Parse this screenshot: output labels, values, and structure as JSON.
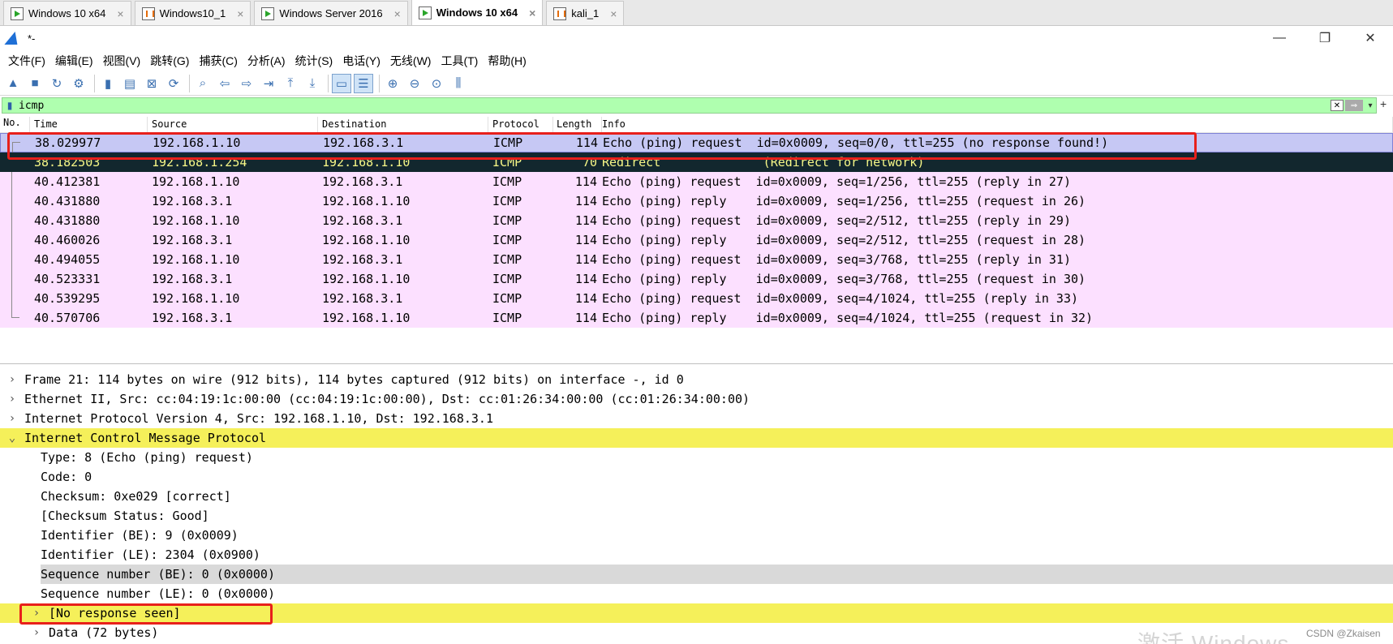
{
  "vm_tabs": [
    {
      "label": "Windows 10 x64",
      "active": false,
      "state": "running"
    },
    {
      "label": "Windows10_1",
      "active": false,
      "state": "paused"
    },
    {
      "label": "Windows Server 2016",
      "active": false,
      "state": "running"
    },
    {
      "label": "Windows 10 x64",
      "active": true,
      "state": "running"
    },
    {
      "label": "kali_1",
      "active": false,
      "state": "paused"
    }
  ],
  "tab_close_glyph": "×",
  "titlebar": {
    "title": "*-",
    "minimize": "—",
    "restore": "❐",
    "close": "✕"
  },
  "menu": [
    "文件(F)",
    "编辑(E)",
    "视图(V)",
    "跳转(G)",
    "捕获(C)",
    "分析(A)",
    "统计(S)",
    "电话(Y)",
    "无线(W)",
    "工具(T)",
    "帮助(H)"
  ],
  "toolbar_icons": [
    "shark-fin-start-icon",
    "stop-capture-icon",
    "restart-capture-icon",
    "capture-options-icon",
    "open-file-icon",
    "save-file-icon",
    "close-file-icon",
    "reload-file-icon",
    "find-packet-icon",
    "go-back-icon",
    "go-forward-icon",
    "go-to-packet-icon",
    "go-first-icon",
    "go-last-icon",
    "autoscroll-icon",
    "colorize-icon",
    "zoom-in-icon",
    "zoom-out-icon",
    "normal-size-icon",
    "resize-columns-icon"
  ],
  "filter": {
    "value": "icmp",
    "clear_glyph": "✕",
    "apply_glyph": "⇒",
    "dropdown_glyph": "▾",
    "add_glyph": "+"
  },
  "packet_list": {
    "columns": [
      "No.",
      "Time",
      "Source",
      "Destination",
      "Protocol",
      "Length",
      "Info"
    ],
    "rows": [
      {
        "time": "38.029977",
        "src": "192.168.1.10",
        "dst": "192.168.3.1",
        "proto": "ICMP",
        "len": "114",
        "info": "Echo (ping) request  id=0x0009, seq=0/0, ttl=255 (no response found!)",
        "style": "selected"
      },
      {
        "time": "38.182503",
        "src": "192.168.1.254",
        "dst": "192.168.1.10",
        "proto": "ICMP",
        "len": "70",
        "info": "Redirect              (Redirect for network)",
        "style": "redirect"
      },
      {
        "time": "40.412381",
        "src": "192.168.1.10",
        "dst": "192.168.3.1",
        "proto": "ICMP",
        "len": "114",
        "info": "Echo (ping) request  id=0x0009, seq=1/256, ttl=255 (reply in 27)",
        "style": "icmp"
      },
      {
        "time": "40.431880",
        "src": "192.168.3.1",
        "dst": "192.168.1.10",
        "proto": "ICMP",
        "len": "114",
        "info": "Echo (ping) reply    id=0x0009, seq=1/256, ttl=255 (request in 26)",
        "style": "icmp"
      },
      {
        "time": "40.431880",
        "src": "192.168.1.10",
        "dst": "192.168.3.1",
        "proto": "ICMP",
        "len": "114",
        "info": "Echo (ping) request  id=0x0009, seq=2/512, ttl=255 (reply in 29)",
        "style": "icmp"
      },
      {
        "time": "40.460026",
        "src": "192.168.3.1",
        "dst": "192.168.1.10",
        "proto": "ICMP",
        "len": "114",
        "info": "Echo (ping) reply    id=0x0009, seq=2/512, ttl=255 (request in 28)",
        "style": "icmp"
      },
      {
        "time": "40.494055",
        "src": "192.168.1.10",
        "dst": "192.168.3.1",
        "proto": "ICMP",
        "len": "114",
        "info": "Echo (ping) request  id=0x0009, seq=3/768, ttl=255 (reply in 31)",
        "style": "icmp"
      },
      {
        "time": "40.523331",
        "src": "192.168.3.1",
        "dst": "192.168.1.10",
        "proto": "ICMP",
        "len": "114",
        "info": "Echo (ping) reply    id=0x0009, seq=3/768, ttl=255 (request in 30)",
        "style": "icmp"
      },
      {
        "time": "40.539295",
        "src": "192.168.1.10",
        "dst": "192.168.3.1",
        "proto": "ICMP",
        "len": "114",
        "info": "Echo (ping) request  id=0x0009, seq=4/1024, ttl=255 (reply in 33)",
        "style": "icmp"
      },
      {
        "time": "40.570706",
        "src": "192.168.3.1",
        "dst": "192.168.1.10",
        "proto": "ICMP",
        "len": "114",
        "info": "Echo (ping) reply    id=0x0009, seq=4/1024, ttl=255 (request in 32)",
        "style": "icmp"
      }
    ]
  },
  "details": {
    "collapsed_glyph": "›",
    "expanded_glyph": "⌄",
    "lines": [
      {
        "text": "Frame 21: 114 bytes on wire (912 bits), 114 bytes captured (912 bits) on interface -, id 0",
        "level": 0,
        "expander": "collapsed",
        "highlight": "none"
      },
      {
        "text": "Ethernet II, Src: cc:04:19:1c:00:00 (cc:04:19:1c:00:00), Dst: cc:01:26:34:00:00 (cc:01:26:34:00:00)",
        "level": 0,
        "expander": "collapsed",
        "highlight": "none"
      },
      {
        "text": "Internet Protocol Version 4, Src: 192.168.1.10, Dst: 192.168.3.1",
        "level": 0,
        "expander": "collapsed",
        "highlight": "none"
      },
      {
        "text": "Internet Control Message Protocol",
        "level": 0,
        "expander": "expanded",
        "highlight": "yellow"
      },
      {
        "text": "Type: 8 (Echo (ping) request)",
        "level": 1,
        "expander": "none",
        "highlight": "none"
      },
      {
        "text": "Code: 0",
        "level": 1,
        "expander": "none",
        "highlight": "none"
      },
      {
        "text": "Checksum: 0xe029 [correct]",
        "level": 1,
        "expander": "none",
        "highlight": "none"
      },
      {
        "text": "[Checksum Status: Good]",
        "level": 1,
        "expander": "none",
        "highlight": "none"
      },
      {
        "text": "Identifier (BE): 9 (0x0009)",
        "level": 1,
        "expander": "none",
        "highlight": "none"
      },
      {
        "text": "Identifier (LE): 2304 (0x0900)",
        "level": 1,
        "expander": "none",
        "highlight": "none"
      },
      {
        "text": "Sequence number (BE): 0 (0x0000)",
        "level": 1,
        "expander": "none",
        "highlight": "gray"
      },
      {
        "text": "Sequence number (LE): 0 (0x0000)",
        "level": 1,
        "expander": "none",
        "highlight": "none"
      },
      {
        "text": "[No response seen]",
        "level": 1,
        "expander": "collapsed",
        "highlight": "yellow"
      },
      {
        "text": "Data (72 bytes)",
        "level": 1,
        "expander": "collapsed",
        "highlight": "none"
      }
    ]
  },
  "overlay": {
    "activate_windows": "激活 Windows",
    "watermark": "CSDN @Zkaisen"
  },
  "colors": {
    "filter_bg": "#afffaf",
    "selected_row": "#c6c8f4",
    "redirect_row_bg": "#12272e",
    "redirect_row_fg": "#f7f787",
    "icmp_row": "#fce0ff",
    "highlight_yellow": "#f5f05a",
    "annotation_red": "#e8201b"
  }
}
